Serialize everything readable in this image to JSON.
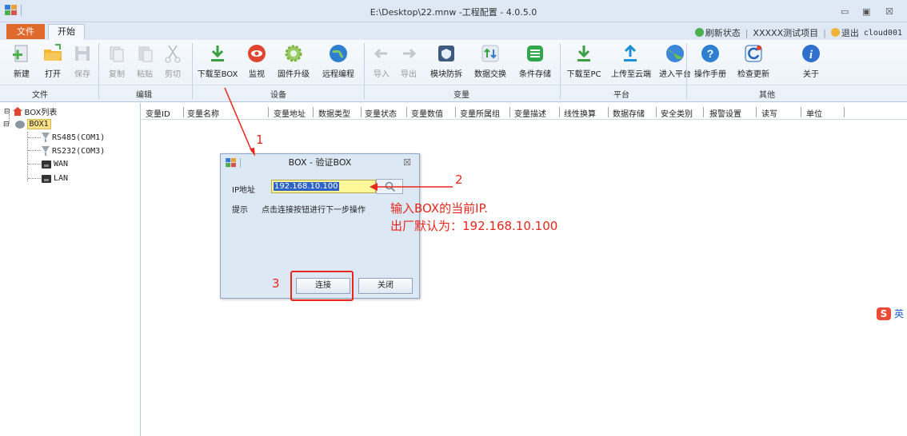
{
  "window": {
    "title": "E:\\Desktop\\22.mnw -工程配置 - 4.0.5.0",
    "minimize": "▭",
    "restore": "▣",
    "close": "☒"
  },
  "menu": {
    "file": "文件",
    "start": "开始",
    "refresh": "刷新状态",
    "project": "XXXXX测试项目",
    "logout": "退出",
    "user": "cloud001"
  },
  "ribbon": {
    "new": "新建",
    "open": "打开",
    "save": "保存",
    "copy": "复制",
    "paste": "粘贴",
    "cut": "剪切",
    "download_box": "下载至BOX",
    "monitor": "监视",
    "firmware": "固件升级",
    "remote": "远程编程",
    "import": "导入",
    "export": "导出",
    "module": "模块防拆",
    "exchange": "数据交换",
    "condition": "条件存储",
    "download_pc": "下载至PC",
    "upload_cloud": "上传至云端",
    "enter_platform": "进入平台",
    "manual": "操作手册",
    "update": "检查更新",
    "about": "关于",
    "groups": {
      "file": "文件",
      "edit": "编辑",
      "device": "设备",
      "variable": "变量",
      "platform": "平台",
      "other": "其他"
    }
  },
  "tree": {
    "root": "BOX列表",
    "box": "BOX1",
    "rs485": "RS485(COM1)",
    "rs232": "RS232(COM3)",
    "wan": "WAN",
    "lan": "LAN"
  },
  "table": {
    "columns": [
      "变量ID",
      "变量名称",
      "变量地址",
      "数据类型",
      "变量状态",
      "变量数值",
      "变量所属组",
      "变量描述",
      "线性换算",
      "数据存储",
      "安全类别",
      "报警设置",
      "读写",
      "单位"
    ]
  },
  "dialog": {
    "title": "BOX - 验证BOX",
    "close": "☒",
    "ip_label": "IP地址",
    "ip_value": "192.168.10.100",
    "hint_label": "提示",
    "hint_text": "点击连接按钮进行下一步操作",
    "connect": "连接",
    "close_btn": "关闭"
  },
  "annotations": {
    "n1": "1",
    "n2": "2",
    "n3": "3",
    "line1": "输入BOX的当前IP.",
    "line2": "出厂默认为：192.168.10.100",
    "color": "#e8261c"
  },
  "ime": {
    "lang": "英",
    "marks": "·,",
    "paren": "("
  }
}
